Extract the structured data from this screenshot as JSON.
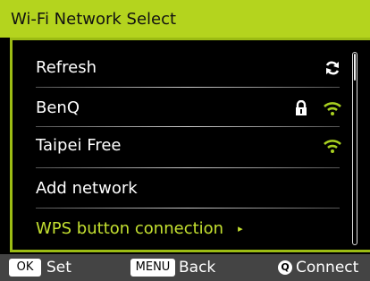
{
  "title": "Wi-Fi Network Select",
  "items": [
    {
      "label": "Refresh"
    },
    {
      "label": "BenQ"
    },
    {
      "label": "Taipei Free"
    },
    {
      "label": "Add network"
    },
    {
      "label": "WPS button connection",
      "arrow": "▸"
    }
  ],
  "footer": {
    "ok_key": "OK",
    "ok_label": "Set",
    "menu_key": "MENU",
    "menu_label": "Back",
    "q_key": "Q",
    "q_label": "Connect"
  },
  "colors": {
    "accent": "#b4d41e",
    "selected_text": "#c4e030",
    "signal": "#a8d020"
  },
  "icons": [
    "refresh-icon",
    "lock-icon",
    "wifi-signal-icon"
  ],
  "scroll": {
    "position": 0.0
  }
}
